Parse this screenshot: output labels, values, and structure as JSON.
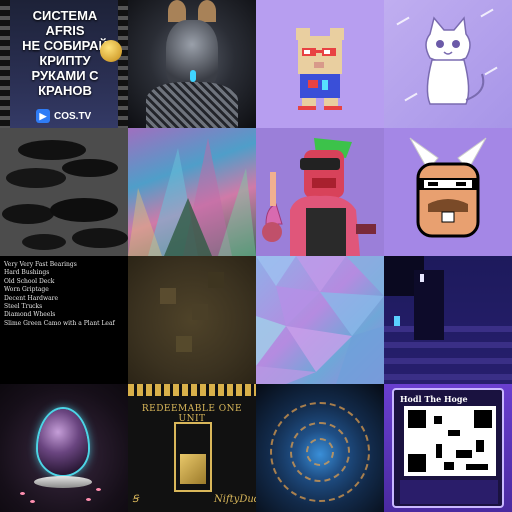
{
  "tiles": [
    {
      "name": "cos-tv-promo",
      "headline_line1": "СИСТЕМА AFRIS",
      "headline_line2": "НЕ СОБИРАЙ КРИПТУ",
      "headline_line3": "РУКАМИ С КРАНОВ",
      "brand": "COS.TV"
    },
    {
      "name": "dark-robot-art"
    },
    {
      "name": "pixel-bear-art"
    },
    {
      "name": "cat-drawing"
    },
    {
      "name": "black-abstract-shapes"
    },
    {
      "name": "crystal-landscape-painting"
    },
    {
      "name": "red-vr-character"
    },
    {
      "name": "pixel-face-art"
    },
    {
      "name": "skateboard-parts-list",
      "lines": [
        "Very Very Fast Bearings",
        "Hard Bushings",
        "Old School Deck",
        "Worn Griptage",
        "Decent Hardware",
        "Steel Trucks",
        "Diamond Wheels",
        "Slime Green Camo with a Plant Leaf"
      ]
    },
    {
      "name": "blurry-brown-image"
    },
    {
      "name": "lowpoly-pastel-art"
    },
    {
      "name": "dark-purple-room"
    },
    {
      "name": "galaxy-egg-art"
    },
    {
      "name": "redeemable-unit-art",
      "title": "REDEEMABLE ONE UNIT",
      "sig_left": "Ꞩ",
      "sig_right": "NiftyDuds"
    },
    {
      "name": "city-swirl-art"
    },
    {
      "name": "hodl-hoge-card",
      "card_title": "Hodl The Hoge"
    }
  ],
  "colors": {
    "cos_logo": "#2f7cf6",
    "egg_glow": "#4dd4e6",
    "gold": "#d9b75a"
  }
}
